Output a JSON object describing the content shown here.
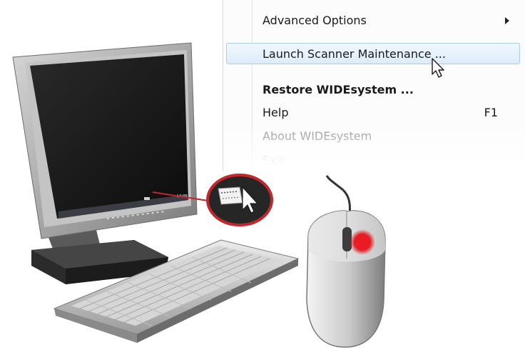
{
  "context_menu": {
    "items": [
      {
        "label": "Advanced Options",
        "submenu": true
      },
      {
        "label": "Launch Scanner Maintenance ...",
        "highlighted": true
      },
      {
        "label": "Restore WIDEsystem ...",
        "bold": true
      },
      {
        "label": "Help",
        "shortcut": "F1"
      },
      {
        "label": "About WIDEsystem",
        "disabled": true
      },
      {
        "label": "Exit",
        "disabled": true
      }
    ]
  },
  "monitor": {
    "taskbar_clock": "13:05"
  },
  "colors": {
    "menu_highlight": "#dcecfb",
    "callout_ring": "#c0282d",
    "mouse_button_press": "#e0161e"
  },
  "icons": [
    "tray-scanner-icon",
    "mouse-pointer-icon",
    "right-mouse-button-icon"
  ]
}
